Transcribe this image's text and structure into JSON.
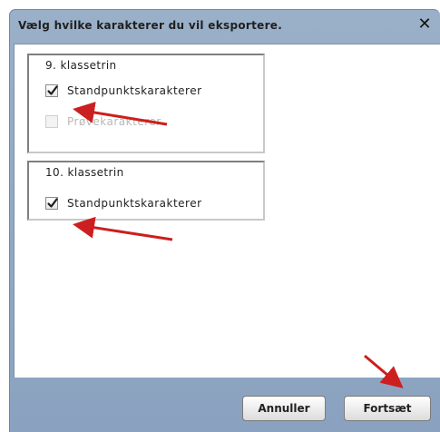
{
  "dialog": {
    "title": "Vælg hvilke karakterer du vil eksportere.",
    "close_symbol": "✕"
  },
  "groups": [
    {
      "label": "9. klassetrin",
      "options": [
        {
          "label": "Standpunktskarakterer",
          "checked": true,
          "enabled": true
        },
        {
          "label": "Prøvekarakterer",
          "checked": false,
          "enabled": false
        }
      ]
    },
    {
      "label": "10. klassetrin",
      "options": [
        {
          "label": "Standpunktskarakterer",
          "checked": true,
          "enabled": true
        }
      ]
    }
  ],
  "buttons": {
    "cancel_label": "Annuller",
    "continue_label": "Fortsæt"
  },
  "annotation_color": "#cc1f1f",
  "icons": {
    "close": "close-icon",
    "check": "checkmark-icon",
    "arrow": "red-arrow-icon"
  }
}
